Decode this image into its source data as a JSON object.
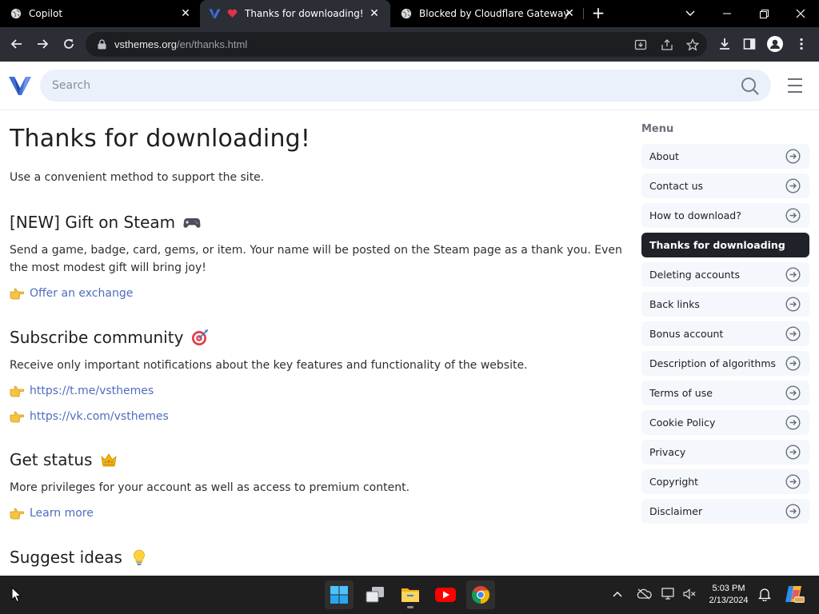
{
  "browser": {
    "tabs": [
      {
        "title": "Copilot",
        "icon": "globe-icon",
        "active": false
      },
      {
        "title": "Thanks for downloading!",
        "icon": "heart-icon",
        "active": true
      },
      {
        "title": "Blocked by Cloudflare Gateway",
        "icon": "globe-icon",
        "active": false
      }
    ],
    "url_host": "vsthemes.org",
    "url_path": "/en/thanks.html"
  },
  "site": {
    "search_placeholder": "Search"
  },
  "main": {
    "title": "Thanks for downloading!",
    "lead": "Use a convenient method to support the site.",
    "sections": [
      {
        "heading": "[NEW] Gift on Steam",
        "emoji": "gamepad-icon",
        "text": "Send a game, badge, card, gems, or item. Your name will be posted on the Steam page as a thank you. Even the most modest gift will bring joy!",
        "links": [
          "Offer an exchange"
        ]
      },
      {
        "heading": "Subscribe community",
        "emoji": "target-icon",
        "text": "Receive only important notifications about the key features and functionality of the website.",
        "links": [
          "https://t.me/vsthemes",
          "https://vk.com/vsthemes"
        ]
      },
      {
        "heading": "Get status",
        "emoji": "crown-icon",
        "text": "More privileges for your account as well as access to premium content.",
        "links": [
          "Learn more"
        ]
      },
      {
        "heading": "Suggest ideas",
        "emoji": "lightbulb-icon",
        "text": "",
        "links": []
      }
    ]
  },
  "sidebar": {
    "heading": "Menu",
    "items": [
      {
        "label": "About",
        "active": false
      },
      {
        "label": "Contact us",
        "active": false
      },
      {
        "label": "How to download?",
        "active": false
      },
      {
        "label": "Thanks for downloading",
        "active": true
      },
      {
        "label": "Deleting accounts",
        "active": false
      },
      {
        "label": "Back links",
        "active": false
      },
      {
        "label": "Bonus account",
        "active": false
      },
      {
        "label": "Description of algorithms",
        "active": false
      },
      {
        "label": "Terms of use",
        "active": false
      },
      {
        "label": "Cookie Policy",
        "active": false
      },
      {
        "label": "Privacy",
        "active": false
      },
      {
        "label": "Copyright",
        "active": false
      },
      {
        "label": "Disclaimer",
        "active": false
      }
    ]
  },
  "taskbar": {
    "time": "5:03 PM",
    "date": "2/13/2024"
  },
  "colors": {
    "link": "#4f6dbd",
    "search_bg": "#eaf1fb",
    "menu_active": "#1f2229",
    "brand": "#3f6fd6"
  }
}
